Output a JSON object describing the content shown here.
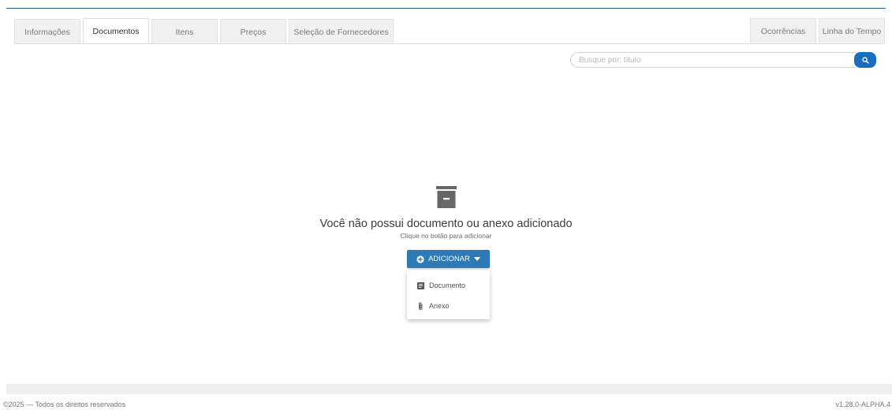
{
  "tabs_left": [
    {
      "label": "Informações",
      "active": false
    },
    {
      "label": "Documentos",
      "active": true
    },
    {
      "label": "Itens",
      "active": false
    },
    {
      "label": "Preços",
      "active": false
    },
    {
      "label": "Seleção de Fornecedores",
      "active": false
    }
  ],
  "tabs_right": [
    {
      "label": "Ocorrências"
    },
    {
      "label": "Linha do Tempo"
    }
  ],
  "search": {
    "placeholder": "Busque por: título",
    "value": "",
    "button_icon": "search-icon"
  },
  "empty_state": {
    "icon": "archive-box-icon",
    "title": "Você não possui documento ou anexo adicionado",
    "subtitle": "Clique no botão para adicionar"
  },
  "add_button": {
    "label": "ADICIONAR",
    "icon": "plus-circle-icon",
    "caret": "caret-down-icon"
  },
  "dropdown": {
    "items": [
      {
        "label": "Documento",
        "icon": "document-icon"
      },
      {
        "label": "Anexo",
        "icon": "paperclip-icon"
      }
    ]
  },
  "footer": {
    "copyright": "©2025 — Todos os direitos reservados",
    "version": "v1.28.0-ALPHA.4"
  },
  "colors": {
    "primary": "#2c7ab8",
    "search_button": "#1b6dbf",
    "icon_gray": "#666666"
  }
}
